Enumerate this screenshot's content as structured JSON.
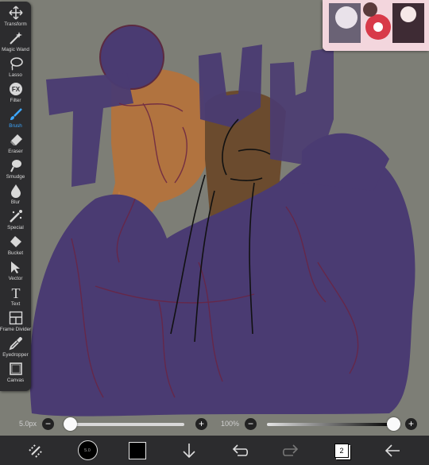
{
  "tools": [
    {
      "label": "Transform",
      "icon": "transform-icon",
      "active": false
    },
    {
      "label": "Magic Wand",
      "icon": "magic-wand-icon",
      "active": false
    },
    {
      "label": "Lasso",
      "icon": "lasso-icon",
      "active": false
    },
    {
      "label": "Filter",
      "icon": "filter-icon",
      "badge": "FX",
      "active": false
    },
    {
      "label": "Brush",
      "icon": "brush-icon",
      "active": true
    },
    {
      "label": "Eraser",
      "icon": "eraser-icon",
      "active": false
    },
    {
      "label": "Smudge",
      "icon": "smudge-icon",
      "active": false
    },
    {
      "label": "Blur",
      "icon": "blur-icon",
      "active": false
    },
    {
      "label": "Special",
      "icon": "special-icon",
      "active": false
    },
    {
      "label": "Bucket",
      "icon": "bucket-icon",
      "active": false
    },
    {
      "label": "Vector",
      "icon": "vector-icon",
      "active": false
    },
    {
      "label": "Text",
      "icon": "text-icon",
      "badge": "T",
      "active": false
    },
    {
      "label": "Frame Divider",
      "icon": "frame-divider-icon",
      "active": false
    },
    {
      "label": "Eyedropper",
      "icon": "eyedropper-icon",
      "active": false
    },
    {
      "label": "Canvas",
      "icon": "canvas-icon",
      "active": false
    }
  ],
  "sliders": {
    "brush_size": {
      "value_text": "5.0px",
      "level": 0.05,
      "minus": "−",
      "plus": "+"
    },
    "opacity": {
      "value_text": "100%",
      "level": 1.0,
      "minus": "−",
      "plus": "+"
    }
  },
  "bottom_bar": {
    "brush_preview_label": "5.0",
    "layer_count": "2",
    "items": [
      "select-tool-icon",
      "brush-preview",
      "color-swatch",
      "download-icon",
      "undo-icon",
      "redo-icon",
      "layers-icon",
      "back-arrow-icon"
    ]
  },
  "colors": {
    "canvas_bg": "#7d7e76",
    "toolbar_bg": "#2c2c2e",
    "active_tool": "#3da7ff",
    "purple_fill": "#4a3b72",
    "skin_left": "#b1733f",
    "skin_right": "#6b4b2e",
    "current_color": "#000000"
  }
}
